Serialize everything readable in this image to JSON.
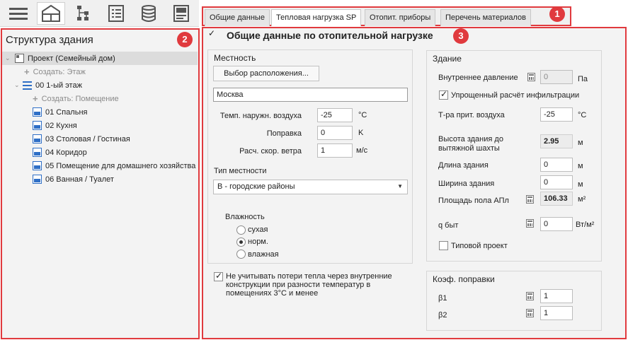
{
  "toolbar": {
    "buttons": [
      {
        "name": "menu-icon"
      },
      {
        "name": "building-structure-icon"
      },
      {
        "name": "network-tree-icon"
      },
      {
        "name": "list-report-icon"
      },
      {
        "name": "database-icon"
      },
      {
        "name": "settings-panel-icon"
      }
    ]
  },
  "left": {
    "title": "Структура здания",
    "badge": "2",
    "tree": {
      "project": "Проект (Семейный дом)",
      "create_floor": "Создать: Этаж",
      "floor": "00 1-ый этаж",
      "create_room": "Создать: Помещение",
      "rooms": [
        "01 Спальня",
        "02 Кухня",
        "03 Столовая / Гостиная",
        "04 Коридор",
        "05 Помещение для домашнего хозяйства",
        "06 Ванная / Туалет"
      ]
    }
  },
  "tabs": {
    "badge": "1",
    "items": [
      "Общие данные",
      "Тепловая нагрузка SP",
      "Отопит. приборы",
      "Перечень материалов"
    ]
  },
  "main": {
    "badge": "3",
    "header": "Общие данные по отопительной нагрузке",
    "locality": {
      "title": "Местность",
      "choose_btn": "Выбор расположения...",
      "city": "Москва",
      "outdoor_temp_label": "Темп. наружн. воздуха",
      "outdoor_temp": "-25",
      "outdoor_temp_unit": "°C",
      "correction_label": "Поправка",
      "correction": "0",
      "correction_unit": "K",
      "wind_label": "Расч. скор. ветра",
      "wind": "1",
      "wind_unit": "м/с",
      "terrain_label": "Тип местности",
      "terrain": "B - городские районы",
      "humidity_label": "Влажность",
      "humidity_options": [
        "сухая",
        "норм.",
        "влажная"
      ]
    },
    "ignore_loss_text": "Не учитывать потери тепла через внутренние конструкции при разности температур в помещениях 3°C и менее",
    "building": {
      "title": "Здание",
      "inner_pressure_label": "Внутреннее давление",
      "inner_pressure": "0",
      "inner_pressure_unit": "Па",
      "simplified_label": "Упрощенный расчёт инфильтрации",
      "supply_temp_label": "Т-ра прит. воздуха",
      "supply_temp": "-25",
      "supply_temp_unit": "°C",
      "height_label_1": "Высота здания до",
      "height_label_2": "вытяжной шахты",
      "height": "2.95",
      "height_unit": "м",
      "length_label": "Длина здания",
      "length": "0",
      "length_unit": "м",
      "width_label": "Ширина здания",
      "width": "0",
      "width_unit": "м",
      "area_label": "Площадь пола АПл",
      "area": "106.33",
      "area_unit": "м²",
      "q_label": "q быт",
      "q": "0",
      "q_unit": "Вт/м²",
      "typical_label": "Типовой проект"
    },
    "coef": {
      "title": "Коэф. поправки",
      "b1_label": "β1",
      "b1": "1",
      "b2_label": "β2",
      "b2": "1"
    }
  }
}
